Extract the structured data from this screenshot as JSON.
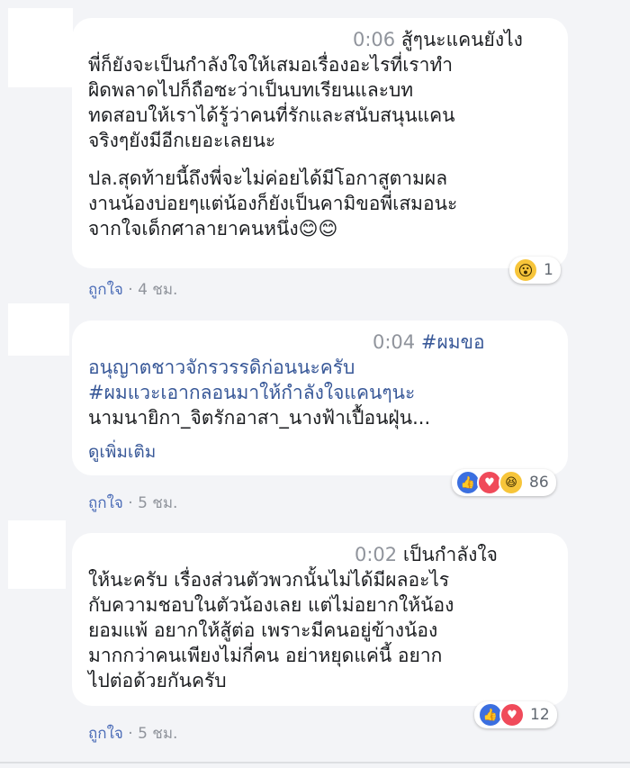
{
  "comments": [
    {
      "time": "0:06",
      "lines": [
        "สู้ๆนะแคนยังไง",
        "พี่ก็ยังจะเป็นกำลังใจให้เสมอเรื่องอะไรที่เราทำ",
        "ผิดพลาดไปก็ถือซะว่าเป็นบทเรียนและบท",
        "ทดสอบให้เราได้รู้ว่าคนที่รักและสนับสนุนแคน",
        "จริงๆยังมีอีกเยอะเลยนะ",
        "ปล.สุดท้ายนี้ถึงพี่จะไม่ค่อยได้มีโอกาสูตามผล",
        "งานน้องบ่อยๆแต่น้องก็ยังเป็นคามิขอพี่เสมอนะ",
        "จากใจเด็กศาลายาคนหนึ่ง"
      ],
      "emoji": "😊😊",
      "like_label": "ถูกใจ",
      "age": "· 4 ชม.",
      "reaction_count": "1"
    },
    {
      "time": "0:04",
      "lines": [
        "#ผมขอ",
        "อนุญาตชาวจักรวรรดิก่อนนะครับ",
        "#ผมแวะเอากลอนมาให้กำลังใจแคนๆนะ",
        "นามนายิกา_จิตรักอาสา_นางฟ้าเปื้อนฝุ่น..."
      ],
      "see_more": "ดูเพิ่มเติม",
      "like_label": "ถูกใจ",
      "age": "· 5 ชม.",
      "reaction_count": "86"
    },
    {
      "time": "0:02",
      "lines": [
        "เป็นกำลังใจ",
        "ให้นะครับ เรื่องส่วนตัวพวกนั้นไม่ได้มีผลอะไร",
        "กับความชอบในตัวน้องเลย แต่ไม่อยากให้น้อง",
        "ยอมแพ้ อยากให้สู้ต่อ เพราะมีคนอยู่ข้างน้อง",
        "มากกว่าคนเพียงไม่กี่คน อย่าหยุดแค่นี้ อยาก",
        "ไปต่อด้วยกันครับ"
      ],
      "like_label": "ถูกใจ",
      "age": "· 5 ชม.",
      "reaction_count": "12"
    }
  ],
  "reaction_icons": {
    "c1": [
      "wow-icon"
    ],
    "c2": [
      "like-icon",
      "love-icon",
      "haha-icon"
    ],
    "c3": [
      "like-icon",
      "love-icon"
    ]
  },
  "colors": {
    "link": "#385898",
    "muted": "#90949c",
    "background": "#f3f4f7",
    "bubble": "#ffffff"
  }
}
